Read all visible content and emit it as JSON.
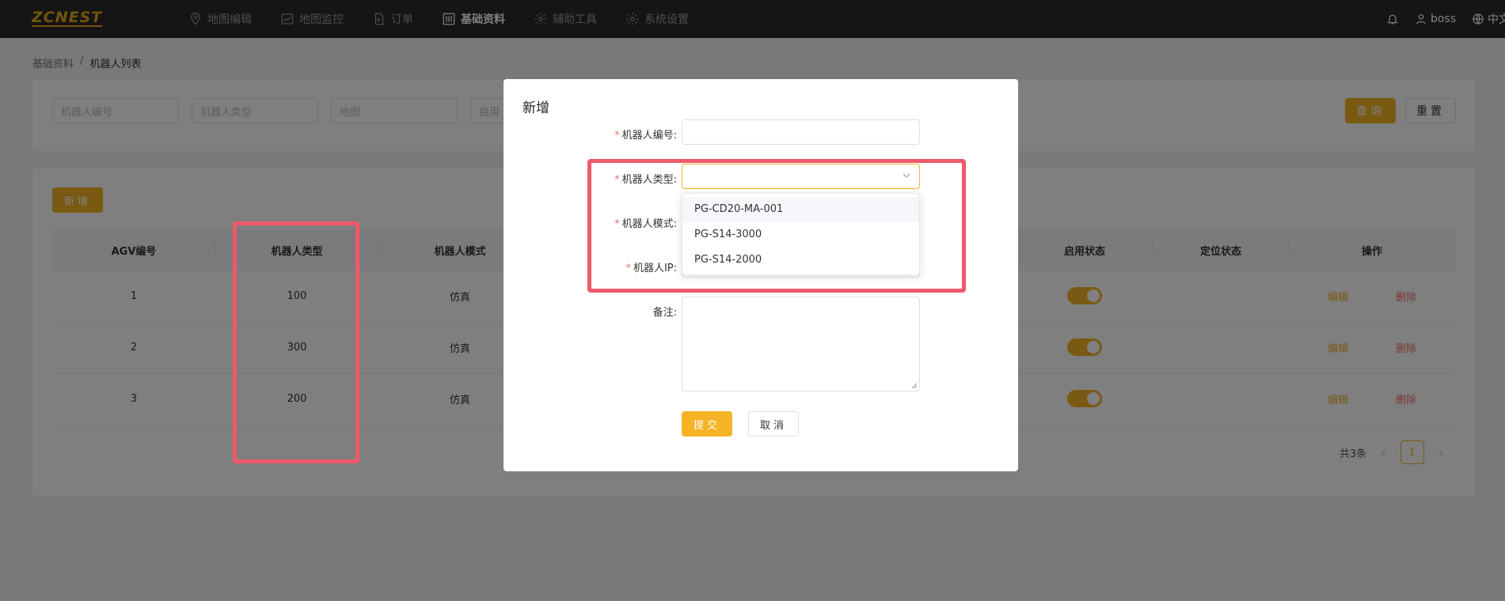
{
  "brand": {
    "logo": "ZCNEST"
  },
  "nav": [
    {
      "label": "地图编辑",
      "icon": "map-pin-icon",
      "active": false
    },
    {
      "label": "地图监控",
      "icon": "chart-line-icon",
      "active": false
    },
    {
      "label": "订单",
      "icon": "document-icon",
      "active": false
    },
    {
      "label": "基础资料",
      "icon": "sliders-icon",
      "active": true
    },
    {
      "label": "辅助工具",
      "icon": "gear-icon",
      "active": false
    },
    {
      "label": "系统设置",
      "icon": "gear-icon",
      "active": false
    }
  ],
  "topright": {
    "user": "boss",
    "lang": "中文"
  },
  "breadcrumb": {
    "root": "基础资料",
    "sep": "/",
    "current": "机器人列表"
  },
  "search": {
    "placeholders": [
      "机器人编号",
      "机器人类型",
      "地图",
      "启用"
    ],
    "query_label": "查询",
    "reset_label": "重置"
  },
  "toolbar": {
    "add_label": "新增"
  },
  "table": {
    "columns": [
      "AGV编号",
      "机器人类型",
      "机器人模式",
      "",
      "",
      "",
      "",
      "启用状态",
      "定位状态",
      "操作"
    ],
    "rows": [
      {
        "id": "1",
        "type": "100",
        "mode": "仿真",
        "enabled": true
      },
      {
        "id": "2",
        "type": "300",
        "mode": "仿真",
        "enabled": true
      },
      {
        "id": "3",
        "type": "200",
        "mode": "仿真",
        "enabled": true
      }
    ],
    "edit_label": "编辑",
    "delete_label": "删除"
  },
  "pagination": {
    "total": "共3条",
    "current": "1"
  },
  "modal": {
    "title": "新增",
    "fields": {
      "robot_no": "机器人编号:",
      "robot_type": "机器人类型:",
      "robot_mode": "机器人模式:",
      "robot_ip": "机器人IP:",
      "remark": "备注:"
    },
    "type_options": [
      "PG-CD20-MA-001",
      "PG-S14-3000",
      "PG-S14-2000"
    ],
    "submit_label": "提交",
    "cancel_label": "取消"
  },
  "colors": {
    "accent": "#f5b325",
    "danger": "#f56c6c",
    "highlight": "#f0586b"
  }
}
